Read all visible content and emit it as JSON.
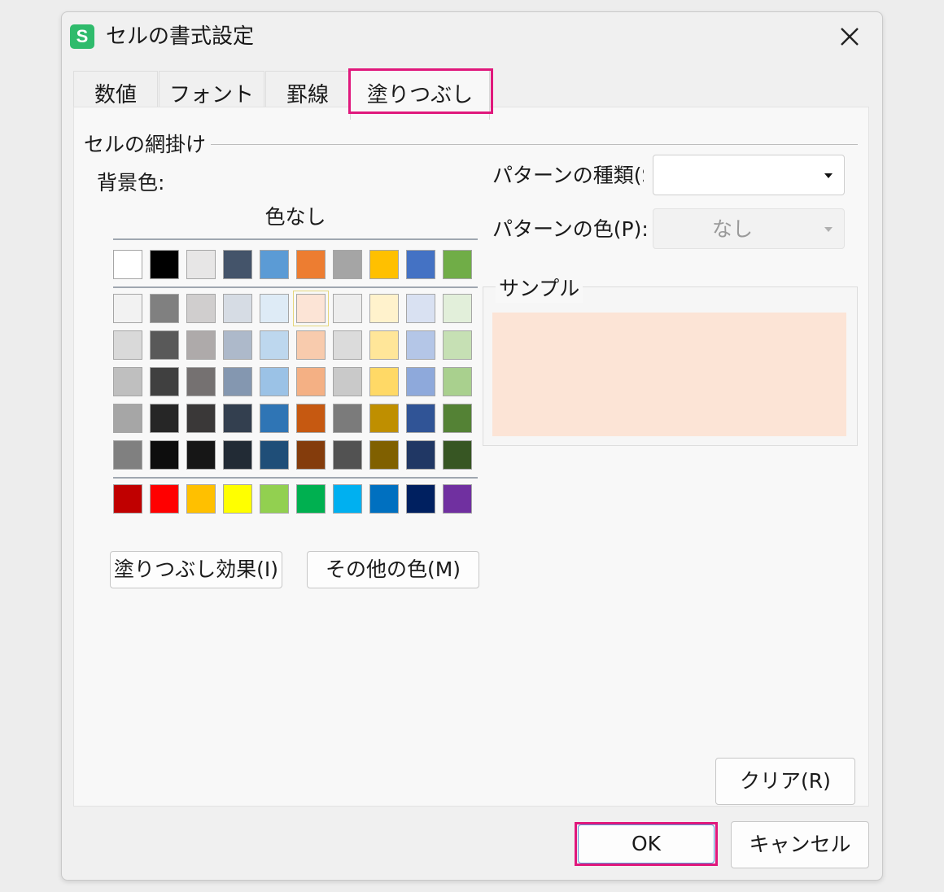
{
  "window": {
    "title": "セルの書式設定",
    "app_icon": "S"
  },
  "tabs": [
    {
      "label": "数値",
      "active": false
    },
    {
      "label": "フォント",
      "active": false
    },
    {
      "label": "罫線",
      "active": false
    },
    {
      "label": "塗りつぶし",
      "active": true
    }
  ],
  "fill": {
    "group_label": "セルの網掛け",
    "background_label": "背景色:",
    "no_color_label": "色なし",
    "selected_color": "#fce4d6",
    "palette": {
      "theme_top": [
        "#ffffff",
        "#000000",
        "#e7e6e6",
        "#44546a",
        "#5b9bd5",
        "#ed7d31",
        "#a5a5a5",
        "#ffc000",
        "#4472c4",
        "#70ad47"
      ],
      "theme_tints": [
        [
          "#f2f2f2",
          "#808080",
          "#d0cece",
          "#d6dce4",
          "#deebf6",
          "#fce4d6",
          "#ededed",
          "#fff2cc",
          "#d9e1f2",
          "#e2efda"
        ],
        [
          "#d9d9d9",
          "#595959",
          "#aeaaaa",
          "#adb9ca",
          "#bdd7ee",
          "#f8cbad",
          "#dbdbdb",
          "#ffe699",
          "#b4c6e7",
          "#c6e0b4"
        ],
        [
          "#bfbfbf",
          "#404040",
          "#757171",
          "#8497b0",
          "#9bc2e6",
          "#f4b084",
          "#c9c9c9",
          "#ffd966",
          "#8ea9db",
          "#a9d08e"
        ],
        [
          "#a6a6a6",
          "#262626",
          "#3a3838",
          "#333f4f",
          "#2f75b5",
          "#c65911",
          "#7b7b7b",
          "#bf8f00",
          "#305496",
          "#548235"
        ],
        [
          "#808080",
          "#0d0d0d",
          "#161616",
          "#222b35",
          "#1f4e78",
          "#843c0c",
          "#525252",
          "#806000",
          "#203764",
          "#375623"
        ]
      ],
      "standard": [
        "#c00000",
        "#ff0000",
        "#ffc000",
        "#ffff00",
        "#92d050",
        "#00b050",
        "#00b0f0",
        "#0070c0",
        "#002060",
        "#7030a0"
      ]
    },
    "fill_effects_button": "塗りつぶし効果(I)",
    "more_colors_button": "その他の色(M)",
    "pattern_style_label": "パターンの種類(S",
    "pattern_style_value": "",
    "pattern_color_label": "パターンの色(P):",
    "pattern_color_value": "なし",
    "sample_label": "サンプル",
    "clear_button": "クリア(R)"
  },
  "footer": {
    "ok_label": "OK",
    "cancel_label": "キャンセル"
  },
  "accent_highlight": "#e0187c"
}
